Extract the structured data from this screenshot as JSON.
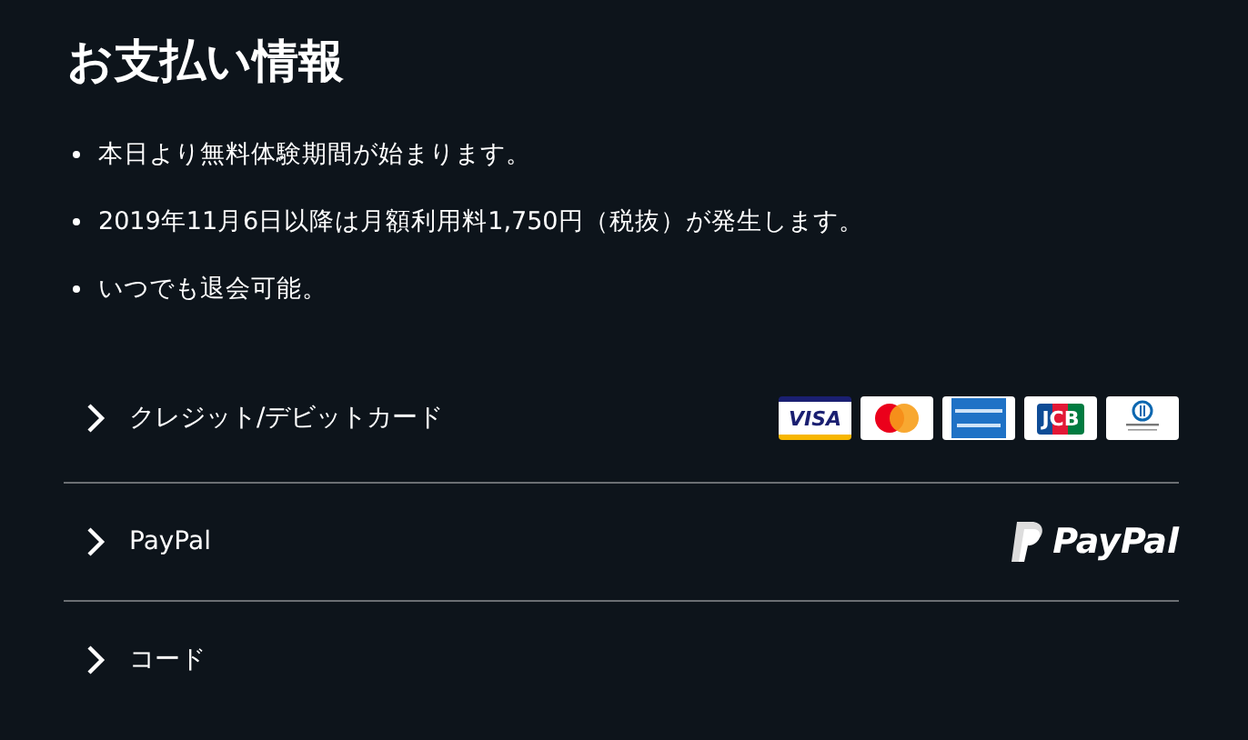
{
  "title": "お支払い情報",
  "notes": [
    "本日より無料体験期間が始まります。",
    "2019年11月6日以降は月額利用料1,750円（税抜）が発生します。",
    "いつでも退会可能。"
  ],
  "methods": [
    {
      "label": "クレジット/デビットカード",
      "kind": "cards",
      "logos": [
        {
          "kind": "visa",
          "text": "VISA"
        },
        {
          "kind": "mastercard"
        },
        {
          "kind": "amex"
        },
        {
          "kind": "jcb",
          "text": "JCB"
        },
        {
          "kind": "diners"
        }
      ]
    },
    {
      "label": "PayPal",
      "kind": "paypal",
      "logo_text": "PayPal"
    },
    {
      "label": "コード",
      "kind": "plain"
    }
  ]
}
